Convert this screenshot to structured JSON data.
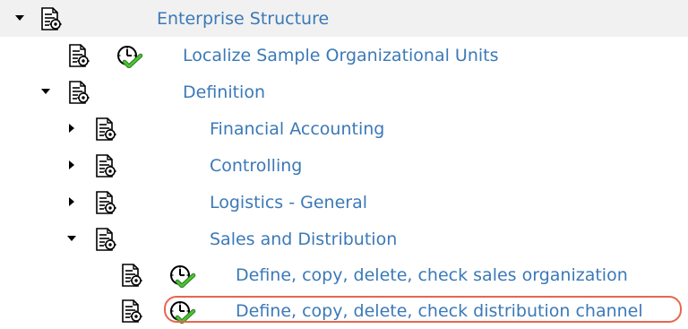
{
  "tree": {
    "root": {
      "label": "Enterprise Structure",
      "icon": "document-gear-icon",
      "expanded": true
    },
    "localize": {
      "label": "Localize Sample Organizational Units",
      "icon": "document-gear-icon",
      "activity_icon": "clock-check-icon"
    },
    "definition": {
      "label": "Definition",
      "icon": "document-gear-icon",
      "expanded": true
    },
    "financial_accounting": {
      "label": "Financial Accounting",
      "icon": "document-gear-icon",
      "expanded": false
    },
    "controlling": {
      "label": "Controlling",
      "icon": "document-gear-icon",
      "expanded": false
    },
    "logistics_general": {
      "label": "Logistics - General",
      "icon": "document-gear-icon",
      "expanded": false
    },
    "sales_distribution": {
      "label": "Sales and Distribution",
      "icon": "document-gear-icon",
      "expanded": true
    },
    "sales_org": {
      "label": "Define, copy, delete, check sales organization",
      "icon": "document-gear-icon",
      "activity_icon": "clock-check-icon"
    },
    "distribution_channel": {
      "label": "Define, copy, delete, check distribution channel",
      "icon": "document-gear-icon",
      "activity_icon": "clock-check-icon",
      "highlighted": true
    }
  },
  "colors": {
    "label_text": "#3b79b7",
    "root_row_background": "#f1f1f1",
    "highlight_ring": "#e8664f",
    "check_mark": "#3fae2a"
  }
}
